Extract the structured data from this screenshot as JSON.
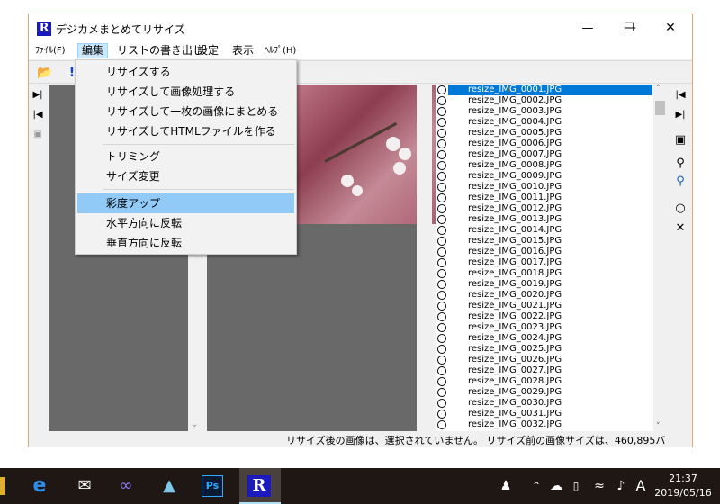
{
  "window": {
    "title": "デジカメまとめてリサイズ",
    "app_icon_letter": "R",
    "minimize": "—",
    "maximize": "☐",
    "close": "✕"
  },
  "menubar": {
    "items": [
      {
        "label": "ﾌｧｲﾙ(F)"
      },
      {
        "label": "編集"
      },
      {
        "label": "リストの書き出し"
      },
      {
        "label": "設定"
      },
      {
        "label": "表示"
      },
      {
        "label": "ﾍﾙﾌﾟ(H)"
      }
    ]
  },
  "dropdown": {
    "items": [
      {
        "label": "リサイズする"
      },
      {
        "label": "リサイズして画像処理する"
      },
      {
        "label": "リサイズして一枚の画像にまとめる"
      },
      {
        "label": "リサイズしてHTMLファイルを作る"
      },
      {
        "label": "トリミング"
      },
      {
        "label": "サイズ変更"
      },
      {
        "label": "彩度アップ"
      },
      {
        "label": "水平方向に反転"
      },
      {
        "label": "垂直方向に反転"
      }
    ]
  },
  "files": [
    "resize_IMG_0001.JPG",
    "resize_IMG_0002.JPG",
    "resize_IMG_0003.JPG",
    "resize_IMG_0004.JPG",
    "resize_IMG_0005.JPG",
    "resize_IMG_0006.JPG",
    "resize_IMG_0007.JPG",
    "resize_IMG_0008.JPG",
    "resize_IMG_0009.JPG",
    "resize_IMG_0010.JPG",
    "resize_IMG_0011.JPG",
    "resize_IMG_0012.JPG",
    "resize_IMG_0013.JPG",
    "resize_IMG_0014.JPG",
    "resize_IMG_0015.JPG",
    "resize_IMG_0016.JPG",
    "resize_IMG_0017.JPG",
    "resize_IMG_0018.JPG",
    "resize_IMG_0019.JPG",
    "resize_IMG_0020.JPG",
    "resize_IMG_0021.JPG",
    "resize_IMG_0022.JPG",
    "resize_IMG_0023.JPG",
    "resize_IMG_0024.JPG",
    "resize_IMG_0025.JPG",
    "resize_IMG_0026.JPG",
    "resize_IMG_0027.JPG",
    "resize_IMG_0028.JPG",
    "resize_IMG_0029.JPG",
    "resize_IMG_0030.JPG",
    "resize_IMG_0031.JPG",
    "resize_IMG_0032.JPG"
  ],
  "selected_file": "resize_IMG_0001.JPG",
  "status": {
    "text": "リサイズ後の画像は、選択されていません。 リサイズ前の画像サイズは、460,895バ"
  },
  "taskbar": {
    "time": "21:37",
    "date": "2019/05/16",
    "ime": "A",
    "active_app_letter": "R",
    "ps_label": "Ps"
  },
  "colors": {
    "selection": "#0078d7",
    "menu_hover": "#91c9f7",
    "window_border": "#e8a36b",
    "taskbar": "#1f1714",
    "app_icon": "#1b1bbd"
  }
}
